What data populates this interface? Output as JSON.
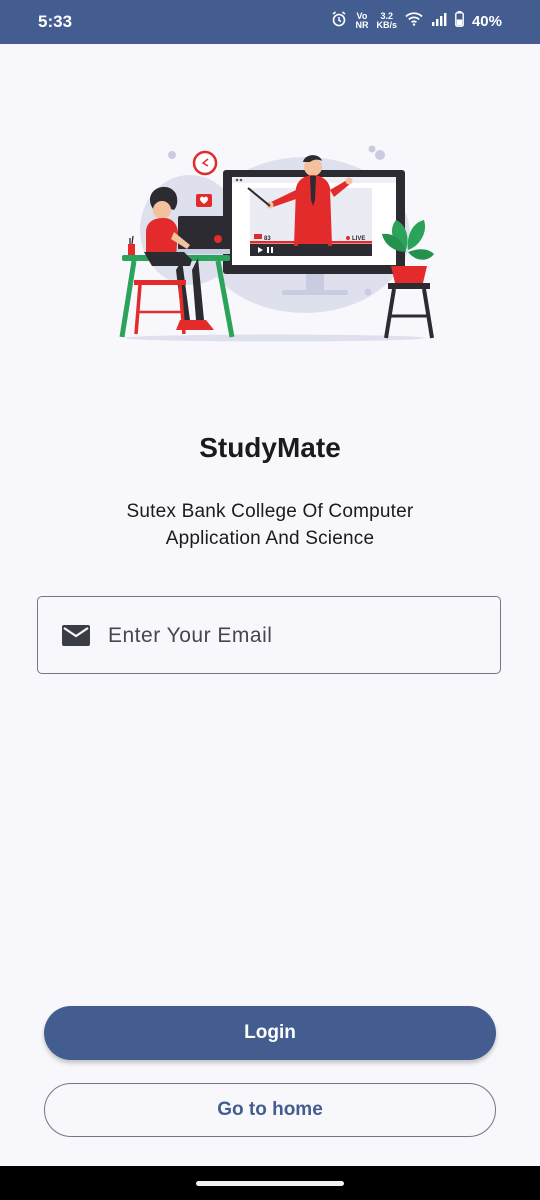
{
  "status_bar": {
    "time": "5:33",
    "network_speed_value": "3.2",
    "network_speed_unit": "KB/s",
    "vo_label": "Vo",
    "nr_label": "NR",
    "battery": "40%"
  },
  "app": {
    "title": "StudyMate",
    "subtitle": "Sutex Bank College Of Computer Application And Science"
  },
  "illustration": {
    "screen_count": "83",
    "screen_live": "LIVE"
  },
  "email": {
    "placeholder": "Enter Your Email",
    "value": ""
  },
  "buttons": {
    "login": "Login",
    "go_home": "Go to home"
  },
  "colors": {
    "primary": "#445d91",
    "background": "#f8f8fc",
    "accent_red": "#e32b2b",
    "accent_green": "#2ca35a"
  }
}
